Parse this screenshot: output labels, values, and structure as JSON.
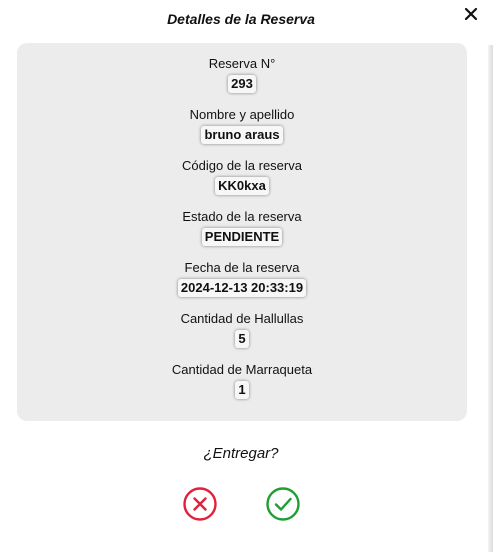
{
  "modal": {
    "title": "Detalles de la Reserva",
    "close_icon": "close-icon"
  },
  "details": [
    {
      "label": "Reserva N°",
      "value": "293"
    },
    {
      "label": "Nombre y apellido",
      "value": "bruno araus"
    },
    {
      "label": "Código de la reserva",
      "value": "KK0kxa"
    },
    {
      "label": "Estado de la reserva",
      "value": "PENDIENTE"
    },
    {
      "label": "Fecha de la reserva",
      "value": "2024-12-13 20:33:19"
    },
    {
      "label": "Cantidad de Hallullas",
      "value": "5"
    },
    {
      "label": "Cantidad de Marraqueta",
      "value": "1"
    }
  ],
  "confirm": {
    "question": "¿Entregar?",
    "reject_icon": "x-circle-icon",
    "accept_icon": "check-circle-icon"
  },
  "colors": {
    "panel_bg": "#ececec",
    "reject": "#e0213b",
    "accept": "#1e9e34"
  }
}
